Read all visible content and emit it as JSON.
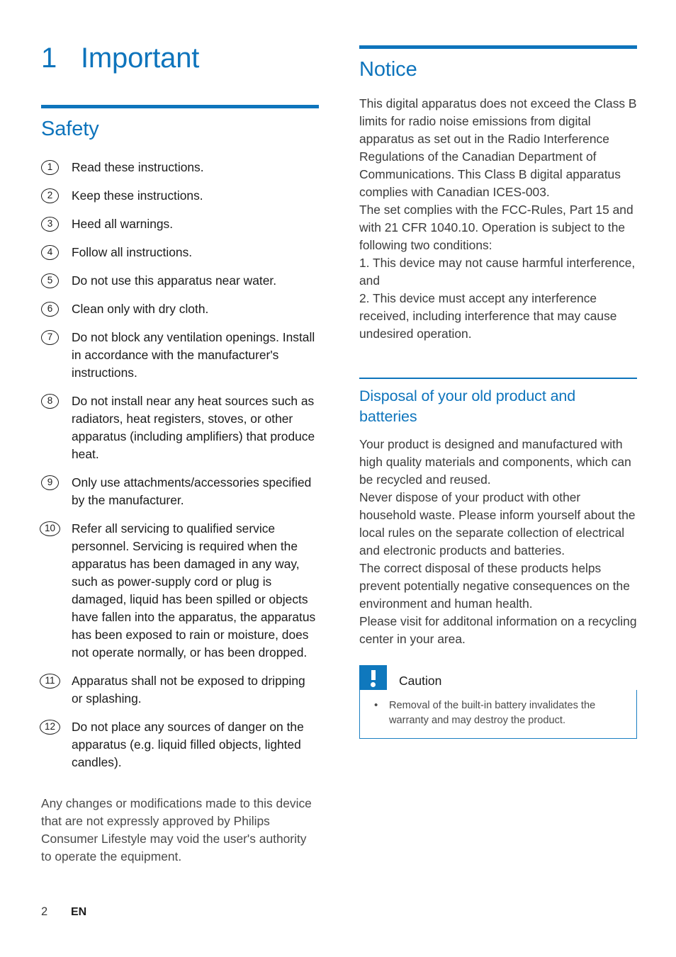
{
  "colors": {
    "accent": "#0e74bc",
    "caution_blue": "#0f78bd",
    "body_text": "#3b3b3b"
  },
  "chapter": {
    "number": "1",
    "title": "Important"
  },
  "left_column": {
    "safety_heading": "Safety",
    "safety_items": [
      {
        "num": "1",
        "text": "Read these instructions."
      },
      {
        "num": "2",
        "text": "Keep these instructions."
      },
      {
        "num": "3",
        "text": "Heed all warnings."
      },
      {
        "num": "4",
        "text": "Follow all instructions."
      },
      {
        "num": "5",
        "text": "Do not use this apparatus near water."
      },
      {
        "num": "6",
        "text": "Clean only with dry cloth."
      },
      {
        "num": "7",
        "text": "Do not block any ventilation openings. Install in accordance with the manufacturer's instructions."
      },
      {
        "num": "8",
        "text": "Do not install near any heat sources such as radiators, heat registers, stoves, or other apparatus (including amplifiers) that produce heat."
      },
      {
        "num": "9",
        "text": "Only use attachments/accessories specified by the manufacturer."
      },
      {
        "num": "10",
        "text": "Refer all servicing to qualified service personnel. Servicing is required when the apparatus has been damaged in any way, such as power-supply cord or plug is damaged, liquid has been spilled or objects have fallen into the apparatus, the apparatus has been exposed to rain or moisture, does not operate normally, or has been dropped."
      },
      {
        "num": "11",
        "text": "Apparatus shall not be exposed to dripping or splashing."
      },
      {
        "num": "12",
        "text": "Do not place any sources of danger on the apparatus (e.g. liquid filled objects, lighted candles)."
      }
    ],
    "closing_paragraph": "Any changes or modifications made to this device that are not expressly approved by Philips Consumer Lifestyle may void the user's authority to operate the equipment."
  },
  "right_column": {
    "notice_heading": "Notice",
    "notice_paragraph": "This digital apparatus does not exceed the Class B limits for radio noise emissions from digital apparatus as set out in the Radio Interference Regulations of the Canadian Department of Communications. This Class B digital apparatus complies with Canadian ICES-003.\nThe set complies with the FCC-Rules, Part 15 and with 21 CFR 1040.10. Operation is subject to the following two conditions:\n1. This device may not cause harmful interference, and\n2. This device must accept any interference received, including interference that may cause undesired operation.",
    "disposal_heading": "Disposal of your old product and batteries",
    "disposal_paragraph": "Your product is designed and manufactured with high quality materials and components, which can be recycled and reused.\nNever dispose of your product with other household waste. Please inform yourself about the local rules on the separate collection of electrical and electronic products and batteries.\nThe correct disposal of these products helps prevent potentially negative consequences on the environment and human health.\nPlease visit for additonal information on a recycling center in your area.",
    "caution": {
      "icon": "exclamation-icon",
      "title": "Caution",
      "items": [
        "Removal of the built-in battery invalidates the warranty and may destroy the product."
      ]
    }
  },
  "footer": {
    "page_number": "2",
    "language": "EN"
  }
}
